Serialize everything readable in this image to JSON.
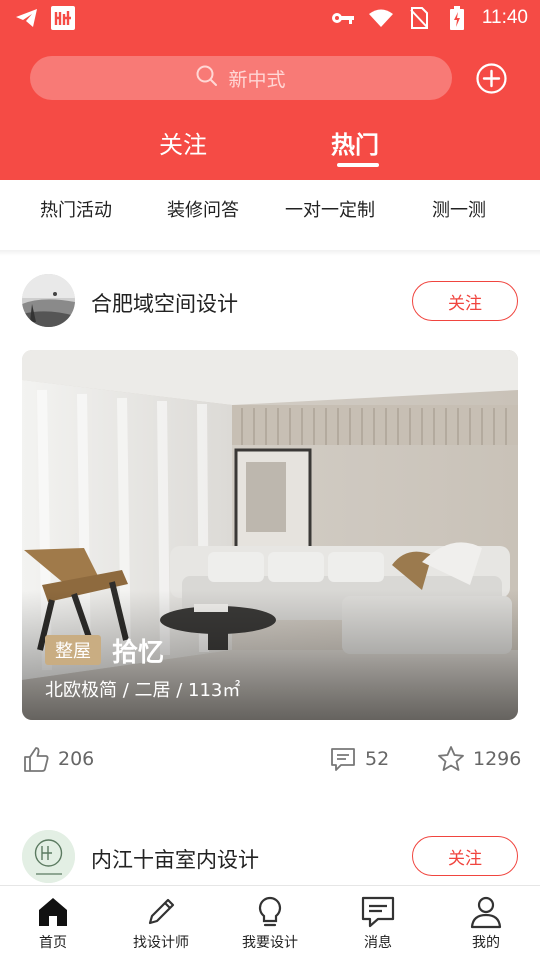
{
  "status_bar": {
    "time": "11:40",
    "left_icons": [
      "telegram-icon",
      "app-logo-icon"
    ],
    "right_icons": [
      "key-icon",
      "wifi-icon",
      "no-sim-icon",
      "battery-icon"
    ]
  },
  "search": {
    "placeholder": "新中式"
  },
  "tabs": [
    {
      "label": "关注",
      "active": false
    },
    {
      "label": "热门",
      "active": true
    }
  ],
  "categories": [
    "热门活动",
    "装修问答",
    "一对一定制",
    "测一测"
  ],
  "posts": [
    {
      "author": "合肥域空间设计",
      "follow_label": "关注",
      "badge": "整屋",
      "title": "拾忆",
      "subtitle": "北欧极简 / 二居 / 113㎡",
      "likes": "206",
      "comments": "52",
      "stars": "1296"
    },
    {
      "author": "内江十亩室内设计",
      "follow_label": "关注"
    }
  ],
  "bottom_nav": [
    {
      "label": "首页",
      "icon": "home-icon",
      "active": true
    },
    {
      "label": "找设计师",
      "icon": "pen-icon",
      "active": false
    },
    {
      "label": "我要设计",
      "icon": "bulb-icon",
      "active": false
    },
    {
      "label": "消息",
      "icon": "message-icon",
      "active": false
    },
    {
      "label": "我的",
      "icon": "user-icon",
      "active": false
    }
  ],
  "colors": {
    "brand": "#f54b45",
    "badge": "#c9ad82"
  }
}
